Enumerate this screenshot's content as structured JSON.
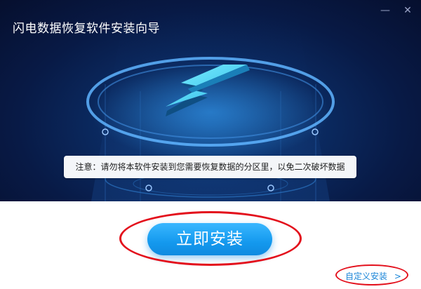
{
  "window": {
    "title": "闪电数据恢复软件安装向导",
    "minimize_label": "—",
    "close_label": "✕"
  },
  "hero": {
    "icon": "lightning-bolt-icon",
    "notice": "注意：请勿将本软件安装到您需要恢复数据的分区里，以免二次破坏数据"
  },
  "actions": {
    "install_label": "立即安装",
    "custom_install_label": "自定义安装",
    "custom_install_arrow": ">"
  },
  "colors": {
    "accent": "#1a9cf0",
    "background_dark": "#081a46",
    "highlight_circle": "#e3101c",
    "link": "#1c86d8"
  }
}
